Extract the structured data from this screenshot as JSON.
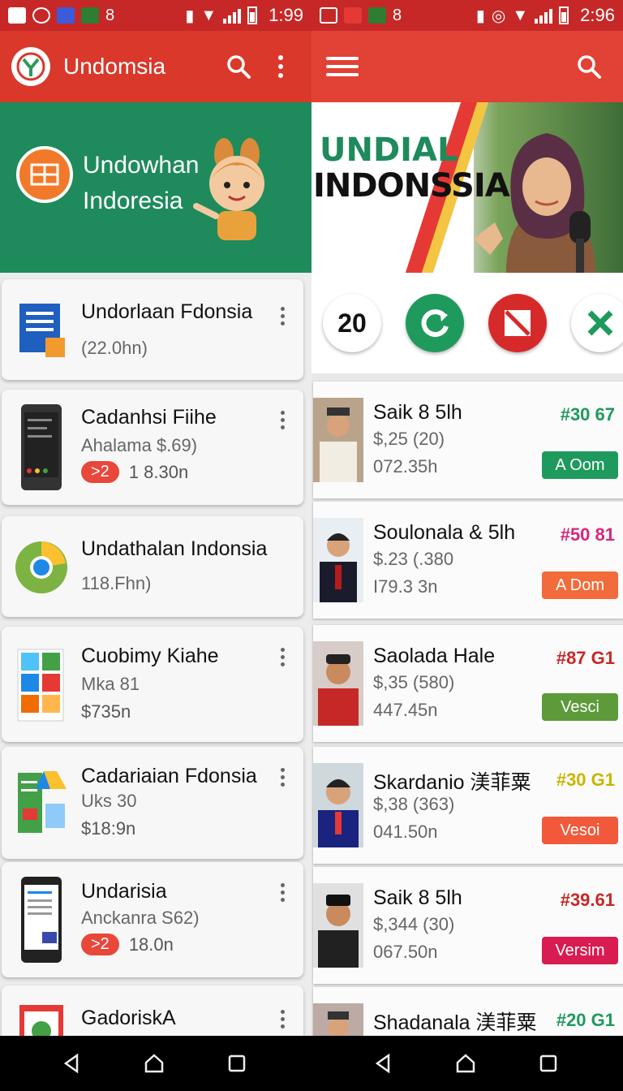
{
  "status_left": {
    "time": "1:99"
  },
  "status_right": {
    "time": "2:96"
  },
  "left": {
    "app_title": "Undomsia",
    "hero": {
      "line1": "Undowhan",
      "line2": "Indoresia"
    },
    "cards": [
      {
        "title": "Undorlaan Fdonsia",
        "subtitle": "(22.0hn)",
        "meta": ""
      },
      {
        "title": "Cadanhsi Fiihe",
        "subtitle": "Ahalama $.69)",
        "badge": ">2",
        "meta": "1 8.30n"
      },
      {
        "title": "Undathalan Indonsia",
        "subtitle": "118.Fhn)",
        "meta": ""
      },
      {
        "title": "Cuobimy Kiahe",
        "subtitle": "Mka 81",
        "meta": "$735n"
      },
      {
        "title": "Cadariaian Fdonsia",
        "subtitle": "Uks 30",
        "meta": "$18:9n"
      },
      {
        "title": "Undarisia",
        "subtitle": "Anckanra S62)",
        "badge": ">2",
        "meta": "18.0n"
      },
      {
        "title": "GadoriskA",
        "subtitle": "",
        "meta": ""
      }
    ]
  },
  "right": {
    "banner": {
      "line1": "UNDIAL",
      "line2": "INDONSSIA"
    },
    "actions": {
      "count": "20"
    },
    "cards": [
      {
        "name": "Saik 8 5lh",
        "price": "#30 67",
        "price_color": "#1f9a5d",
        "line2": "$,25 (20)",
        "line3": "072.35h",
        "button": "A Oom",
        "button_color": "#1f9a5d"
      },
      {
        "name": "Soulonala & 5lh",
        "price": "#50 81",
        "price_color": "#d6287a",
        "line2": "$.23 (.380",
        "line3": "I79.3 3n",
        "button": "A Dom",
        "button_color": "#f26b3a"
      },
      {
        "name": "Saolada Hale",
        "price": "#87 G1",
        "price_color": "#c62828",
        "line2": "$,35 (580)",
        "line3": "447.45n",
        "button": "Vesci",
        "button_color": "#5d9a3a"
      },
      {
        "name": "Skardanio 渼菲粟",
        "price": "#30 G1",
        "price_color": "#c9b500",
        "line2": "$,38 (363)",
        "line3": "041.50n",
        "button": "Vesoi",
        "button_color": "#f2593a"
      },
      {
        "name": "Saik 8 5lh",
        "price": "#39.61",
        "price_color": "#c62828",
        "line2": "$,344 (30)",
        "line3": "067.50n",
        "button": "Versim",
        "button_color": "#d81b50"
      },
      {
        "name": "Shadanala 渼菲粟",
        "price": "#20 G1",
        "price_color": "#1f9a5d",
        "line2": "",
        "line3": "",
        "button": "",
        "button_color": "#1f9a5d"
      }
    ]
  },
  "icons": [
    "search-icon",
    "more-vert-icon",
    "menu-icon",
    "refresh-icon",
    "block-icon",
    "close-icon",
    "back-icon",
    "home-icon",
    "recents-icon"
  ]
}
